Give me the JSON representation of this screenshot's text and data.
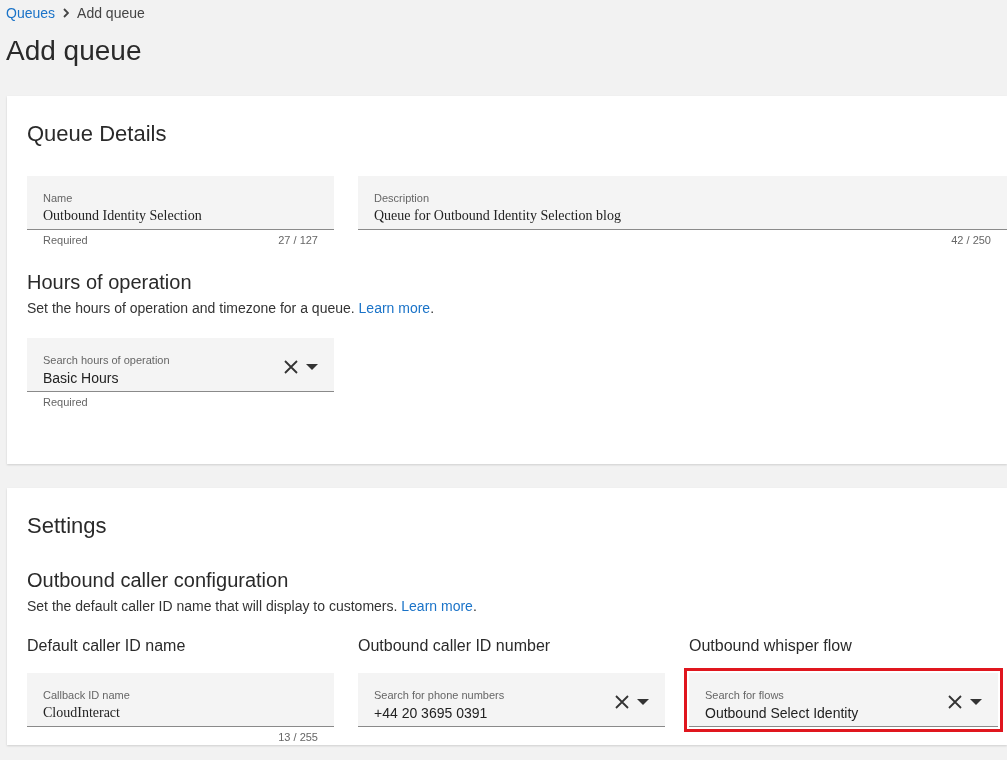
{
  "breadcrumb": [
    {
      "label": "Queues",
      "kind": "link"
    },
    {
      "label": "Add queue",
      "kind": "current"
    }
  ],
  "title": "Add queue",
  "cards": [
    {
      "title": "Queue Details",
      "blocks": [
        {
          "kind": "fields",
          "fields": [
            {
              "kind": "text",
              "label": "Name",
              "value": "Outbound Identity Selection",
              "helper": "Required",
              "counter": "27 / 127"
            },
            {
              "kind": "text",
              "label": "Description",
              "value": "Queue for Outbound Identity Selection blog",
              "counter": "42 / 250"
            }
          ]
        },
        {
          "kind": "subsection",
          "title": "Hours of operation",
          "description": {
            "text": "Set the hours of operation and timezone for a queue.",
            "link": "Learn more",
            "end": "."
          }
        },
        {
          "kind": "fields",
          "fields": [
            {
              "kind": "select",
              "label": "Search hours of operation",
              "value": "Basic Hours",
              "helper": "Required"
            }
          ]
        }
      ]
    },
    {
      "title": "Settings",
      "blocks": [
        {
          "kind": "subsection",
          "title": "Outbound caller configuration",
          "description": {
            "text": "Set the default caller ID name that will display to customers.",
            "link": "Learn more",
            "end": "."
          }
        },
        {
          "kind": "columns",
          "fields": [
            {
              "heading": "Default caller ID name",
              "kind": "text",
              "label": "Callback ID name",
              "value": "CloudInteract",
              "counter": "13 / 255"
            },
            {
              "heading": "Outbound caller ID number",
              "kind": "select",
              "label": "Search for phone numbers",
              "value": "+44 20 3695 0391"
            },
            {
              "heading": "Outbound whisper flow",
              "kind": "select",
              "label": "Search for flows",
              "value": "Outbound Select Identity",
              "highlighted": true
            }
          ]
        }
      ]
    }
  ]
}
